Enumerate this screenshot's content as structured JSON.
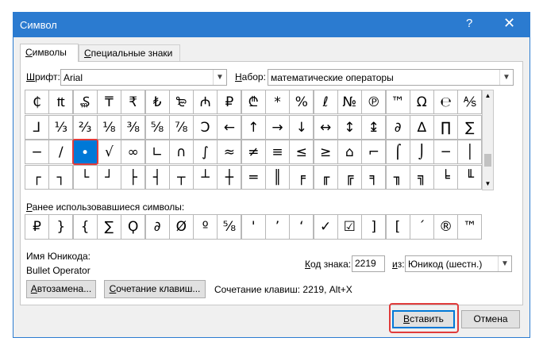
{
  "window": {
    "title": "Символ",
    "help": "?",
    "close": "✕"
  },
  "tabs": [
    {
      "label": "Символы",
      "u": "С",
      "rest": "имволы"
    },
    {
      "label": "Специальные знаки",
      "u": "С",
      "rest": "пециальные знаки"
    }
  ],
  "font": {
    "label_u": "Ш",
    "label_rest": "рифт:",
    "value": "Arial"
  },
  "subset": {
    "label_u": "Н",
    "label_rest": "абор:",
    "value": "математические операторы"
  },
  "symbols": [
    [
      "₵",
      "₶",
      "₷",
      "₸",
      "₹",
      "₺",
      "₻",
      "₼",
      "₽",
      "₾",
      "*",
      "%",
      "ℓ",
      "№",
      "℗",
      "™",
      "Ω",
      "℮",
      "⅍"
    ],
    [
      "⅃",
      "⅓",
      "⅔",
      "⅛",
      "⅜",
      "⅝",
      "⅞",
      "Ↄ",
      "←",
      "↑",
      "→",
      "↓",
      "↔",
      "↕",
      "↨",
      "∂",
      "∆",
      "∏",
      "∑"
    ],
    [
      "−",
      "∕",
      "∙",
      "√",
      "∞",
      "∟",
      "∩",
      "∫",
      "≈",
      "≠",
      "≡",
      "≤",
      "≥",
      "⌂",
      "⌐",
      "⌠",
      "⌡",
      "─",
      "│"
    ],
    [
      "┌",
      "┐",
      "└",
      "┘",
      "├",
      "┤",
      "┬",
      "┴",
      "┼",
      "═",
      "║",
      "╒",
      "╓",
      "╔",
      "╕",
      "╖",
      "╗",
      "╘",
      "╙"
    ]
  ],
  "selected": {
    "row": 2,
    "col": 2
  },
  "recent": {
    "label_u": "Р",
    "label_rest": "анее использовавшиеся символы:",
    "items": [
      "₽",
      "}",
      "{",
      "∑",
      "Ϙ",
      "∂",
      "Ø",
      "º",
      "⅝",
      "'",
      "’",
      "‘",
      "✓",
      "☑",
      "]",
      "[",
      "´",
      "®",
      "™"
    ]
  },
  "unicode_name": {
    "label": "Имя Юникода:",
    "value": "Bullet Operator"
  },
  "char_code": {
    "label_u": "К",
    "label_rest": "од знака:",
    "value": "2219"
  },
  "from": {
    "label_u": "и",
    "label_rest": "з:",
    "value": "Юникод (шестн.)"
  },
  "autocorrect_button": {
    "u": "А",
    "rest": "втозамена..."
  },
  "shortcut_button": {
    "u": "С",
    "rest": "очетание клавиш..."
  },
  "shortcut_info": "Сочетание клавиш: 2219, Alt+X",
  "insert_button": {
    "u": "В",
    "rest": "ставить"
  },
  "cancel_button": "Отмена"
}
